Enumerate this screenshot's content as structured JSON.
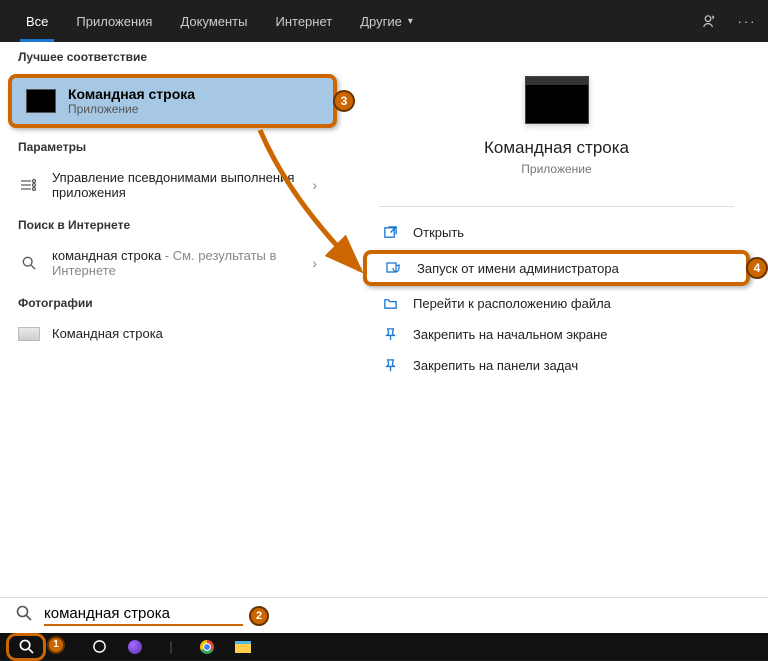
{
  "tabs": {
    "all": "Все",
    "apps": "Приложения",
    "documents": "Документы",
    "internet": "Интернет",
    "more": "Другие"
  },
  "left": {
    "best_match_header": "Лучшее соответствие",
    "best_match": {
      "title": "Командная строка",
      "subtitle": "Приложение"
    },
    "params_header": "Параметры",
    "params_item": "Управление псевдонимами выполнения приложения",
    "web_header": "Поиск в Интернете",
    "web_item_term": "командная строка",
    "web_item_suffix": " - См. результаты в Интернете",
    "photos_header": "Фотографии",
    "photos_item": "Командная строка"
  },
  "right": {
    "title": "Командная строка",
    "subtitle": "Приложение",
    "actions": {
      "open": "Открыть",
      "run_admin": "Запуск от имени администратора",
      "open_location": "Перейти к расположению файла",
      "pin_start": "Закрепить на начальном экране",
      "pin_taskbar": "Закрепить на панели задач"
    }
  },
  "search": {
    "query": "командная строка"
  },
  "badges": {
    "b1": "1",
    "b2": "2",
    "b3": "3",
    "b4": "4"
  }
}
